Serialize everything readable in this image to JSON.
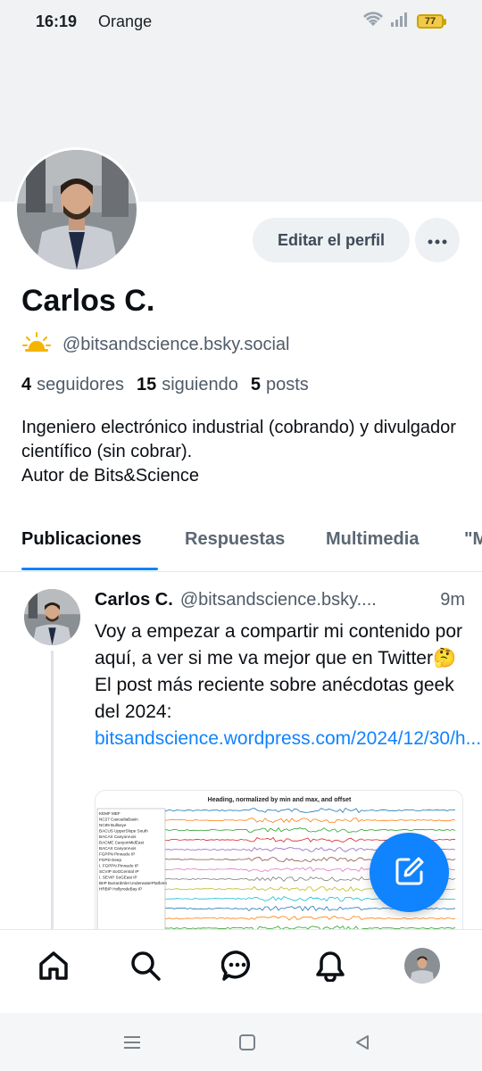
{
  "status_bar": {
    "time": "16:19",
    "carrier": "Orange",
    "battery": "77",
    "icons": [
      "wifi-icon",
      "signal-icon",
      "battery-icon"
    ]
  },
  "profile": {
    "edit_button": "Editar el perfil",
    "name": "Carlos C.",
    "handle": "@bitsandscience.bsky.social",
    "handle_icon": "sun-cloud-emoji",
    "followers_count": "4",
    "followers_label": "seguidores",
    "following_count": "15",
    "following_label": "siguiendo",
    "posts_count": "5",
    "posts_label": "posts",
    "bio_line1": "Ingeniero electrónico industrial (cobrando) y divulgador científico (sin cobrar).",
    "bio_line2": "Autor de Bits&Science"
  },
  "tabs": {
    "items": [
      "Publicaciones",
      "Respuestas",
      "Multimedia",
      "\"M"
    ],
    "active": "Publicaciones"
  },
  "post": {
    "author": "Carlos C.",
    "handle": "@bitsandscience.bsky....",
    "time": "9m",
    "text": "Voy a empezar a compartir mi contenido por aquí, a ver si me va mejor que en Twitter🤔 El post más reciente sobre anécdotas geek del 2024: ",
    "link": "bitsandscience.wordpress.com/2024/12/30/h...",
    "image": {
      "title": "Heading, normalized by min and max, and offset",
      "legend": [
        "KEMF MEF",
        "NC27 CascadiaBasin",
        "NC89 Bullseye",
        "BACUS UpperSlope South",
        "BACAX CanyonAxis",
        "BACME CanyonMidEast",
        "BACAX CanyonAxis",
        "FGPPN Pinnacle IP",
        "FGPD Deep",
        "I. FGPPN Pinnacle IP",
        "SCVIP SoGCentral IP",
        "I. SEVIP SoGEast IP",
        "BIIP BurrardInlet UnderwaterPlatform",
        "HRBIP HollyrodeBay IP"
      ],
      "series_colors": [
        "#1f77b4",
        "#ff7f0e",
        "#2ca02c",
        "#d62728",
        "#9467bd",
        "#8c564b",
        "#e377c2",
        "#7f7f7f",
        "#bcbd22",
        "#17becf",
        "#1f77b4",
        "#ff7f0e",
        "#2ca02c",
        "#d62728"
      ]
    }
  },
  "bottom_nav": [
    "home-icon",
    "search-icon",
    "chat-icon",
    "bell-icon",
    "profile-avatar"
  ],
  "colors": {
    "accent": "#1083fe",
    "text": "#0b0f14",
    "muted": "#4f5b68",
    "banner": "#f0f2f4"
  }
}
